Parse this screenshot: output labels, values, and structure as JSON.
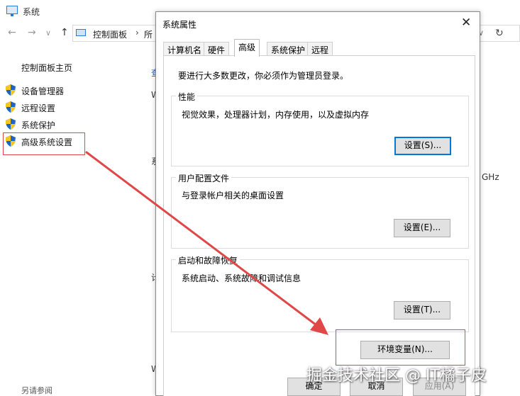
{
  "bg_window": {
    "title": "系统",
    "nav": {
      "back": "←",
      "forward": "→",
      "dropdown": "∨",
      "up": "↑"
    },
    "address": {
      "crumb1": "控制面板",
      "chevron": "›",
      "crumb2": "所"
    },
    "address_right": {
      "dropdown": "∨",
      "refresh": "↻"
    },
    "left_pane": {
      "home": "控制面板主页",
      "items": [
        {
          "label": "设备管理器"
        },
        {
          "label": "远程设置"
        },
        {
          "label": "系统保护"
        },
        {
          "label": "高级系统设置"
        }
      ],
      "see_also": "另请参阅"
    },
    "fragments": {
      "f1": "查",
      "f2": "W",
      "f3": "系",
      "f4": "计",
      "f5": "W",
      "ghz": "GHz"
    }
  },
  "dialog": {
    "title": "系统属性",
    "close": "✕",
    "tabs": [
      {
        "label": "计算机名"
      },
      {
        "label": "硬件"
      },
      {
        "label": "高级"
      },
      {
        "label": "系统保护"
      },
      {
        "label": "远程"
      }
    ],
    "active_tab": "高级",
    "admin_note": "要进行大多数更改，你必须作为管理员登录。",
    "performance": {
      "title": "性能",
      "desc": "视觉效果，处理器计划，内存使用，以及虚拟内存",
      "button": "设置(S)..."
    },
    "user_profile": {
      "title": "用户配置文件",
      "desc": "与登录帐户相关的桌面设置",
      "button": "设置(E)..."
    },
    "startup": {
      "title": "启动和故障恢复",
      "desc": "系统启动、系统故障和调试信息",
      "button": "设置(T)..."
    },
    "env_button": "环境变量(N)...",
    "bottom_buttons": {
      "ok": "确定",
      "cancel": "取消",
      "apply": "应用(A)"
    }
  },
  "watermark": "掘金技术社区 @ IT橘子皮",
  "colors": {
    "annotation_red": "#e04848",
    "accent_blue": "#0078d7",
    "shield_blue": "#1f66c2",
    "shield_yellow": "#f3c623"
  }
}
